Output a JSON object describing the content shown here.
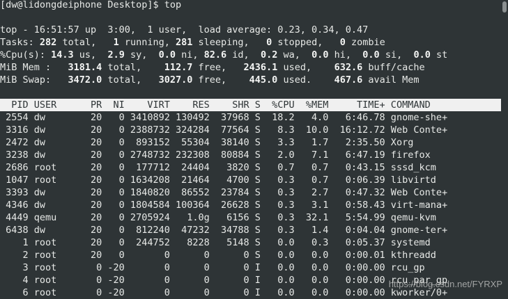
{
  "prompt": "[dw@lidongdeiphone Desktop]$ top",
  "summary": {
    "line1": "top - 16:51:57 up  3:00,  1 user,  load average: 0.23, 0.34, 0.47",
    "tasks": {
      "label": "Tasks:",
      "total": "282",
      "total_l": " total,   ",
      "running": "1",
      "running_l": " running, ",
      "sleeping": "281",
      "sleeping_l": " sleeping,   ",
      "stopped": "0",
      "stopped_l": " stopped,   ",
      "zombie": "0",
      "zombie_l": " zombie"
    },
    "cpu": {
      "label": "%Cpu(s): ",
      "us": "14.3",
      "us_l": " us,  ",
      "sy": "2.9",
      "sy_l": " sy,  ",
      "ni": "0.0",
      "ni_l": " ni, ",
      "id": "82.6",
      "id_l": " id,  ",
      "wa": "0.2",
      "wa_l": " wa,  ",
      "hi": "0.0",
      "hi_l": " hi,  ",
      "si": "0.0",
      "si_l": " si,  ",
      "st": "0.0",
      "st_l": " st"
    },
    "mem": {
      "label": "MiB Mem :   ",
      "total": "3181.4",
      "total_l": " total,    ",
      "free": "112.7",
      "free_l": " free,   ",
      "used": "2436.1",
      "used_l": " used,    ",
      "buff": "632.6",
      "buff_l": " buff/cache"
    },
    "swap": {
      "label": "MiB Swap:   ",
      "total": "3472.0",
      "total_l": " total,   ",
      "free": "3027.0",
      "free_l": " free,    ",
      "used": "445.0",
      "used_l": " used.    ",
      "avail": "467.6",
      "avail_l": " avail Mem"
    }
  },
  "table": {
    "header": "  PID USER      PR  NI    VIRT    RES    SHR S  %CPU  %MEM     TIME+ COMMAND     ",
    "rows": [
      " 2554 dw        20   0 3410892 130492  37968 S  18.2   4.0   6:46.78 gnome-she+",
      " 3316 dw        20   0 2388732 324284  77564 S   8.3  10.0  16:12.72 Web Conte+",
      " 2472 dw        20   0  893152  55304  38140 S   3.3   1.7   2:35.50 Xorg",
      " 3238 dw        20   0 2748732 232308  80884 S   2.0   7.1   6:47.19 firefox",
      " 2686 root      20   0  177712  24404   3820 S   0.7   0.7   0:43.15 sssd_kcm",
      " 1047 root      20   0 1634208  21464   4700 S   0.3   0.7   0:06.39 libvirtd",
      " 3393 dw        20   0 1840820  86552  23784 S   0.3   2.7   0:47.32 Web Conte+",
      " 4346 dw        20   0 1804584 100364  26628 S   0.3   3.1   0:58.43 virt-mana+",
      " 4449 qemu      20   0 2705924   1.0g   6156 S   0.3  32.1   5:54.99 qemu-kvm",
      " 6438 dw        20   0  812240  47232  34788 S   0.3   1.4   0:04.04 gnome-ter+",
      "    1 root      20   0  244752   8228   5148 S   0.0   0.3   0:05.37 systemd",
      "    2 root      20   0       0      0      0 S   0.0   0.0   0:00.01 kthreadd",
      "    3 root       0 -20       0      0      0 I   0.0   0.0   0:00.00 rcu_gp",
      "    4 root       0 -20       0      0      0 I   0.0   0.0   0:00.00 rcu_par_gp",
      "    6 root       0 -20       0      0      0 I   0.0   0.0   0:00.00 kworker/0+"
    ]
  },
  "watermark": "https://blog.csdn.net/FYRXP"
}
